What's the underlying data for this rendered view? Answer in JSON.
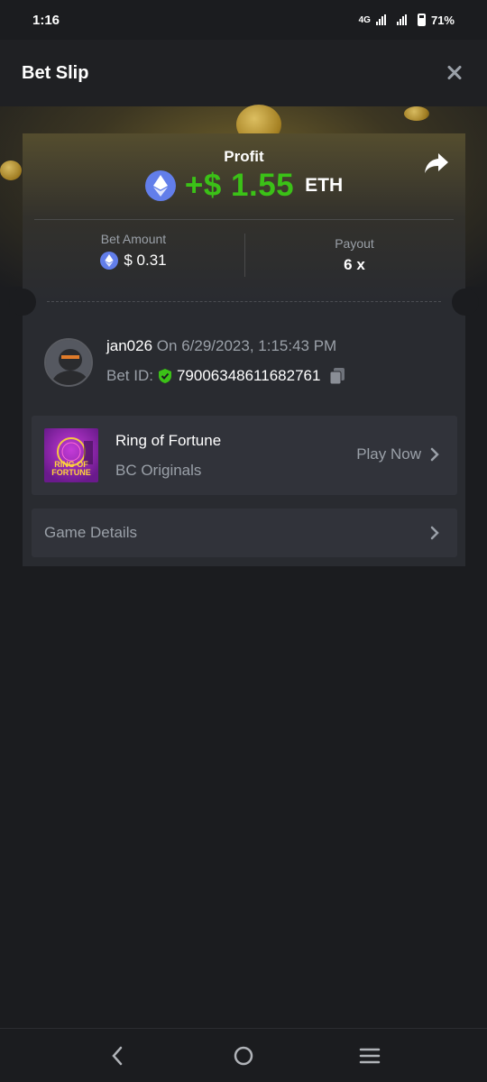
{
  "status_bar": {
    "time": "1:16",
    "network": "4G",
    "battery": "71%"
  },
  "header": {
    "title": "Bet Slip"
  },
  "profit": {
    "label": "Profit",
    "value": "+$ 1.55",
    "currency": "ETH"
  },
  "bet_amount": {
    "label": "Bet Amount",
    "value": "$ 0.31"
  },
  "payout": {
    "label": "Payout",
    "value": "6 x"
  },
  "user": {
    "username": "jan026",
    "timestamp": "On 6/29/2023, 1:15:43 PM",
    "bet_id_label": "Bet ID:",
    "bet_id": "79006348611682761"
  },
  "game": {
    "name": "Ring of Fortune",
    "provider": "BC Originals",
    "action": "Play Now",
    "thumb_text": "RING OF FORTUNE"
  },
  "details": {
    "label": "Game Details"
  },
  "colors": {
    "profit": "#3bc117",
    "eth": "#627eea",
    "background": "#1b1c1f",
    "card": "#292b30"
  }
}
